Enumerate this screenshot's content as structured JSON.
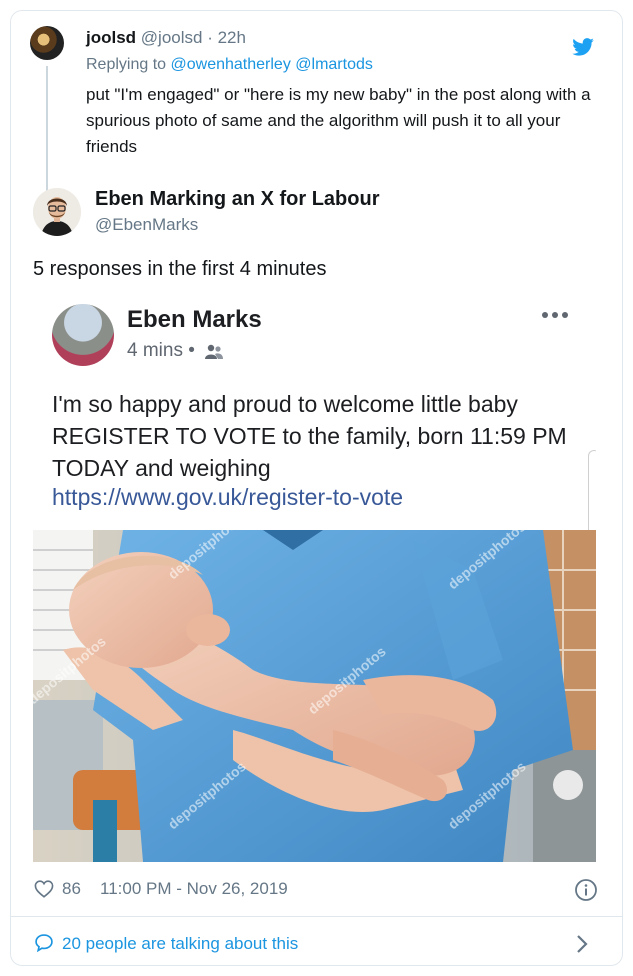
{
  "reply_tweet": {
    "display_name": "joolsd",
    "handle": "@joolsd",
    "separator": " · ",
    "time_ago": "22h",
    "replying_to_prefix": "Replying to ",
    "mentions": [
      "@owenhatherley",
      "@lmartods"
    ],
    "text": "put \"I'm engaged\" or \"here is my new baby\" in the post along with a spurious photo of same and the algorithm will push it to all your friends"
  },
  "main_tweet": {
    "display_name": "Eben Marking an X for Labour",
    "handle": "@EbenMarks",
    "text": "5 responses in the first 4 minutes",
    "like_count": "86",
    "timestamp": "11:00 PM - Nov 26, 2019",
    "conversation_label": "20 people are talking about this"
  },
  "embedded_post": {
    "author": "Eben Marks",
    "time": "4 mins",
    "dot": " • ",
    "text": "I'm so happy and proud to welcome little baby REGISTER TO VOTE to the family, born 11:59 PM TODAY and weighing",
    "link": "https://www.gov.uk/register-to-vote",
    "watermark": "depositphotos"
  },
  "icons": {
    "brand": "twitter-bird-icon",
    "like": "heart-icon",
    "info": "info-icon",
    "conversation": "speech-bubble-icon",
    "more": "more-horizontal-icon",
    "audience": "friends-icon",
    "navigate": "chevron-right-icon"
  },
  "colors": {
    "twitter_blue": "#1da1f2",
    "link_blue": "#1b95e0",
    "facebook_link": "#385898",
    "muted_text": "#657786",
    "scrubs": "#4f9bd6"
  }
}
